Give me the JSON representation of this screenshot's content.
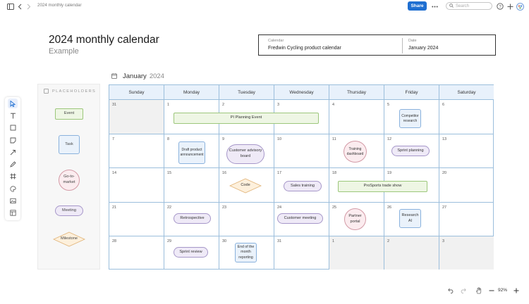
{
  "topbar": {
    "doc_title": "2024 monthly calendar",
    "share_label": "Share",
    "search_placeholder": "Search"
  },
  "header": {
    "title": "2024 monthly calendar",
    "subtitle": "Example",
    "calendar_label": "Calendar",
    "calendar_value": "Fredwin Cycling product calendar",
    "date_label": "Date",
    "date_value": "January 2024"
  },
  "month_header": {
    "month": "January",
    "year": "2024"
  },
  "placeholders": {
    "title": "PLACEHOLDERS",
    "items": [
      "Event",
      "Task",
      "Go-to-market",
      "Meeting",
      "Milestone"
    ]
  },
  "calendar": {
    "weekdays": [
      "Sunday",
      "Monday",
      "Tuesday",
      "Wednesday",
      "Thursday",
      "Friday",
      "Saturday"
    ],
    "days": [
      [
        "31",
        "1",
        "2",
        "3",
        "4",
        "5",
        "6"
      ],
      [
        "7",
        "8",
        "9",
        "10",
        "11",
        "12",
        "13"
      ],
      [
        "14",
        "15",
        "16",
        "17",
        "18",
        "19",
        "20"
      ],
      [
        "21",
        "22",
        "23",
        "24",
        "25",
        "26",
        "27"
      ],
      [
        "28",
        "29",
        "30",
        "31",
        "1",
        "2",
        "3"
      ]
    ],
    "events": {
      "pi_planning": "PI Planning Event",
      "competitor_research": "Competitor research",
      "draft_announcement": "Draft product announcement",
      "customer_advisory": "Customer advisory board",
      "training_dashboard": "Training dashboard",
      "sprint_planning": "Sprint planning",
      "code": "Code",
      "sales_training": "Sales training",
      "prosports_show": "ProSports trade show",
      "retrospective": "Retrospective",
      "customer_meeting": "Customer meeting",
      "partner_portal": "Partner portal",
      "research_ai": "Research AI",
      "sprint_review": "Sprint review",
      "end_of_month": "End of the month reporting"
    }
  },
  "zoom": {
    "level": "92%"
  },
  "colors": {
    "accent": "#1f6fd1",
    "grid_border": "#9bbedc",
    "header_fill": "#e8f1fb",
    "event_fill": "#eef6e4",
    "task_fill": "#eaf2fb",
    "gtm_fill": "#fbecef",
    "meeting_fill": "#efeaf7",
    "milestone_fill": "#fdf0dc"
  }
}
